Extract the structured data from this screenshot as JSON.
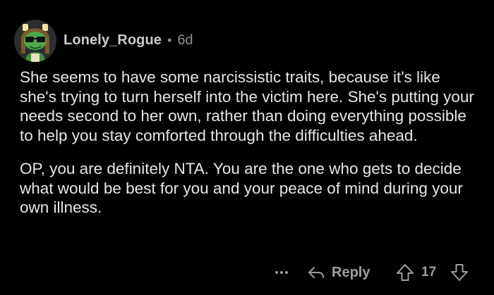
{
  "comment": {
    "author": "Lonely_Rogue",
    "separator": "•",
    "age": "6d",
    "avatar_icon": "snoo-avatar-icon",
    "paragraphs": [
      "She seems to have some narcissistic traits, because it's like she's trying to turn herself into the victim here. She's putting your needs second to her own, rather than doing everything possible to help you stay comforted through the difficulties ahead.",
      "OP, you are definitely NTA. You are the one who gets to decide what would be best for you and your peace of mind during your own illness."
    ]
  },
  "actions": {
    "more_icon": "ellipsis-icon",
    "reply_icon": "reply-arrow-icon",
    "reply_label": "Reply",
    "upvote_icon": "upvote-arrow-icon",
    "vote_count": "17",
    "downvote_icon": "downvote-arrow-icon"
  },
  "colors": {
    "background": "#000000",
    "text": "#e5e6e7",
    "muted": "#9a9ea2"
  }
}
